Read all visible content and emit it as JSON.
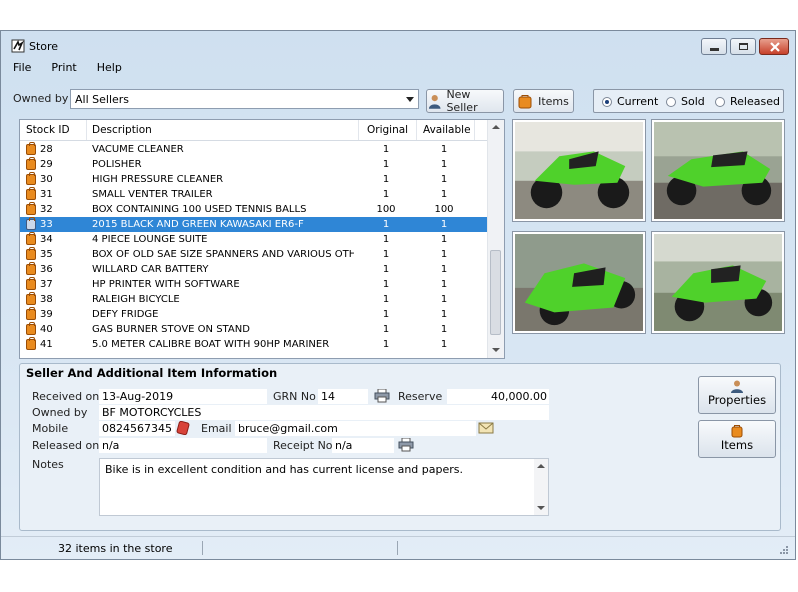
{
  "window": {
    "title": "Store"
  },
  "menu": {
    "items": [
      "File",
      "Print",
      "Help"
    ]
  },
  "filter": {
    "owned_by_label": "Owned by",
    "owned_by_value": "All Sellers",
    "new_seller_label": "New Seller",
    "items_label": "Items",
    "radios": [
      {
        "label": "Current",
        "checked": true
      },
      {
        "label": "Sold",
        "checked": false
      },
      {
        "label": "Released",
        "checked": false
      }
    ]
  },
  "grid": {
    "columns": [
      "Stock ID",
      "Description",
      "Original",
      "Available"
    ],
    "rows": [
      {
        "id": "28",
        "desc": "VACUME CLEANER",
        "orig": "1",
        "avail": "1"
      },
      {
        "id": "29",
        "desc": "POLISHER",
        "orig": "1",
        "avail": "1"
      },
      {
        "id": "30",
        "desc": "HIGH PRESSURE CLEANER",
        "orig": "1",
        "avail": "1"
      },
      {
        "id": "31",
        "desc": "SMALL VENTER TRAILER",
        "orig": "1",
        "avail": "1"
      },
      {
        "id": "32",
        "desc": "BOX CONTAINING 100 USED TENNIS BALLS",
        "orig": "100",
        "avail": "100"
      },
      {
        "id": "33",
        "desc": "2015 BLACK AND GREEN KAWASAKI ER6-F",
        "orig": "1",
        "avail": "1",
        "selected": true
      },
      {
        "id": "34",
        "desc": "4 PIECE LOUNGE SUITE",
        "orig": "1",
        "avail": "1"
      },
      {
        "id": "35",
        "desc": "BOX OF OLD SAE SIZE SPANNERS AND VARIOUS OTHER...",
        "orig": "1",
        "avail": "1"
      },
      {
        "id": "36",
        "desc": "WILLARD CAR BATTERY",
        "orig": "1",
        "avail": "1"
      },
      {
        "id": "37",
        "desc": "HP PRINTER WITH SOFTWARE",
        "orig": "1",
        "avail": "1"
      },
      {
        "id": "38",
        "desc": "RALEIGH BICYCLE",
        "orig": "1",
        "avail": "1"
      },
      {
        "id": "39",
        "desc": "DEFY FRIDGE",
        "orig": "1",
        "avail": "1"
      },
      {
        "id": "40",
        "desc": "GAS BURNER STOVE ON STAND",
        "orig": "1",
        "avail": "1"
      },
      {
        "id": "41",
        "desc": "5.0 METER CALIBRE BOAT WITH 90HP MARINER",
        "orig": "1",
        "avail": "1"
      }
    ]
  },
  "details": {
    "section_title": "Seller And Additional Item Information",
    "received_on_label": "Received on",
    "received_on": "13-Aug-2019",
    "grn_label": "GRN No",
    "grn": "14",
    "reserve_label": "Reserve",
    "reserve": "40,000.00",
    "owned_by_label": "Owned by",
    "owned_by": "BF MOTORCYCLES",
    "mobile_label": "Mobile",
    "mobile": "0824567345",
    "email_label": "Email",
    "email": "bruce@gmail.com",
    "released_on_label": "Released on",
    "released_on": "n/a",
    "receipt_label": "Receipt No",
    "receipt": "n/a",
    "notes_label": "Notes",
    "notes": "Bike is in excellent condition and has current license and papers."
  },
  "side_buttons": {
    "properties": "Properties",
    "items": "Items"
  },
  "status": {
    "text": "32 items in the store"
  },
  "colors": {
    "selection": "#2f86d6",
    "bike_green": "#4fd12b",
    "tag_orange": "#e98b1f"
  },
  "photos": [
    "bike-photo-1",
    "bike-photo-2",
    "bike-photo-3",
    "bike-photo-4"
  ]
}
